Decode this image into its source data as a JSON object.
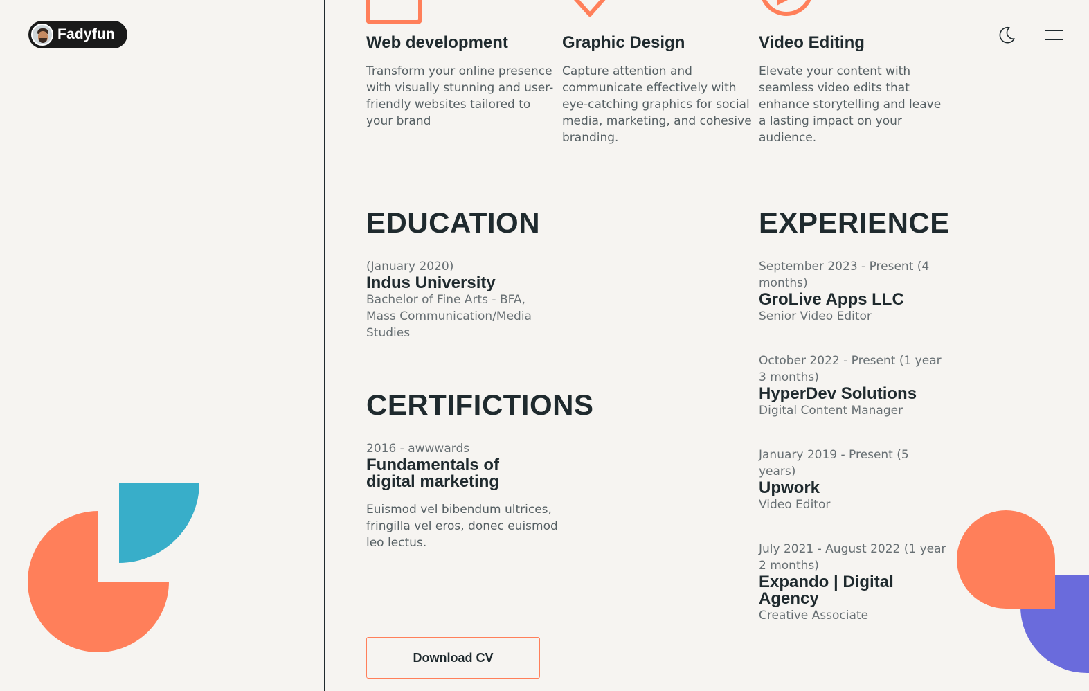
{
  "brand": {
    "name": "Fadyfun"
  },
  "colors": {
    "accent": "#ff7f5a",
    "teal": "#38aec9",
    "purple": "#6a6bdc",
    "background": "#f6f4f1",
    "text": "#1f2a2e"
  },
  "header": {
    "theme_toggle_icon": "moon-icon",
    "menu_icon": "hamburger-menu-icon"
  },
  "services": [
    {
      "icon": "square-outline-icon",
      "title": "Web development",
      "description": "Transform your online presence with visually stunning and user-friendly websites tailored to your brand"
    },
    {
      "icon": "diamond-outline-icon",
      "title": "Graphic Design",
      "description": "Capture attention and communicate effectively with eye-catching graphics for social media, marketing, and cohesive branding."
    },
    {
      "icon": "play-circle-icon",
      "title": "Video Editing",
      "description": "Elevate your content with seamless video edits that enhance storytelling and leave a lasting impact on your audience."
    }
  ],
  "education": {
    "heading": "EDUCATION",
    "items": [
      {
        "date": "(January 2020)",
        "school": "Indus University",
        "degree": "Bachelor of Fine Arts - BFA, Mass Communication/Media Studies"
      }
    ]
  },
  "certifications": {
    "heading": "CERTIFICTIONS",
    "items": [
      {
        "meta": "2016 - awwwards",
        "title": "Fundamentals of digital marketing",
        "description": "Euismod vel bibendum ultrices, fringilla vel eros, donec euismod leo lectus."
      }
    ]
  },
  "experience": {
    "heading": "EXPERIENCE",
    "items": [
      {
        "period": "September 2023 - Present (4 months)",
        "company": "GroLive Apps LLC",
        "role": "Senior Video Editor"
      },
      {
        "period": "October 2022 - Present (1 year 3 months)",
        "company": "HyperDev Solutions",
        "role": "Digital Content Manager"
      },
      {
        "period": "January 2019 - Present (5 years)",
        "company": "Upwork",
        "role": "Video Editor"
      },
      {
        "period": "July 2021 - August 2022 (1 year 2 months)",
        "company": "Expando | Digital Agency",
        "role": "Creative Associate"
      }
    ]
  },
  "cta": {
    "download_label": "Download CV"
  }
}
